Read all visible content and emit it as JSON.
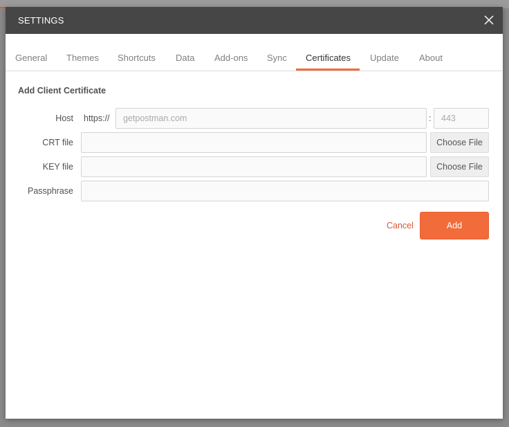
{
  "dialog": {
    "title": "SETTINGS"
  },
  "tabs": [
    {
      "label": "General"
    },
    {
      "label": "Themes"
    },
    {
      "label": "Shortcuts"
    },
    {
      "label": "Data"
    },
    {
      "label": "Add-ons"
    },
    {
      "label": "Sync"
    },
    {
      "label": "Certificates",
      "active": true
    },
    {
      "label": "Update"
    },
    {
      "label": "About"
    }
  ],
  "form": {
    "section_title": "Add Client Certificate",
    "host": {
      "label": "Host",
      "prefix": "https://",
      "value": "",
      "placeholder": "getpostman.com",
      "separator": ":",
      "port_value": "",
      "port_placeholder": "443"
    },
    "crt": {
      "label": "CRT file",
      "value": "",
      "button": "Choose File"
    },
    "key": {
      "label": "KEY file",
      "value": "",
      "button": "Choose File"
    },
    "passphrase": {
      "label": "Passphrase",
      "value": ""
    }
  },
  "actions": {
    "cancel_label": "Cancel",
    "add_label": "Add"
  },
  "colors": {
    "accent": "#f26b3a",
    "titlebar": "#464646",
    "cancel_text": "#e0562d"
  },
  "icons": {
    "close": "close-icon"
  }
}
